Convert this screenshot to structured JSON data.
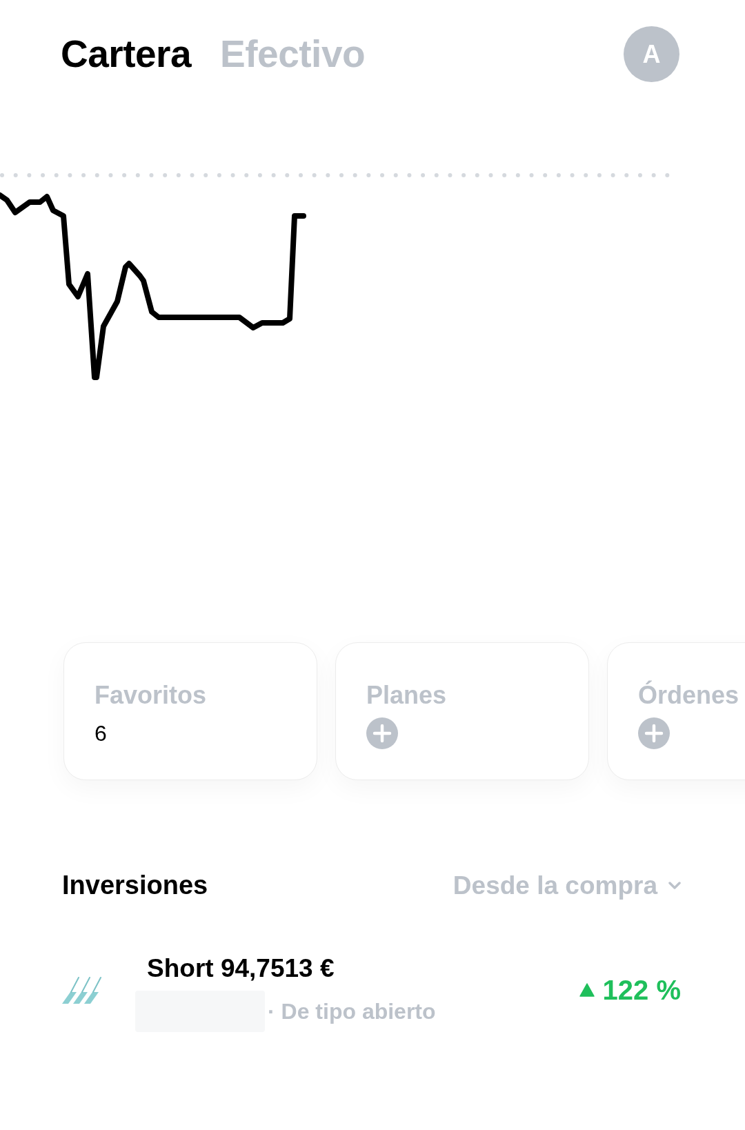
{
  "header": {
    "tabs": [
      {
        "label": "Cartera",
        "selected": true
      },
      {
        "label": "Efectivo",
        "selected": false
      }
    ],
    "avatar": {
      "initial": "A"
    }
  },
  "shortcuts": [
    {
      "label": "Favoritos",
      "kind": "count",
      "value": "6"
    },
    {
      "label": "Planes",
      "kind": "add"
    },
    {
      "label": "Órdenes",
      "kind": "add"
    }
  ],
  "investments": {
    "title": "Inversiones",
    "period": {
      "label": "Desde la compra"
    },
    "items": [
      {
        "name": "Short 94,7513 €",
        "redacted": true,
        "subtitle": "· De tipo abierto",
        "change": "122 %",
        "rising": true
      }
    ]
  }
}
